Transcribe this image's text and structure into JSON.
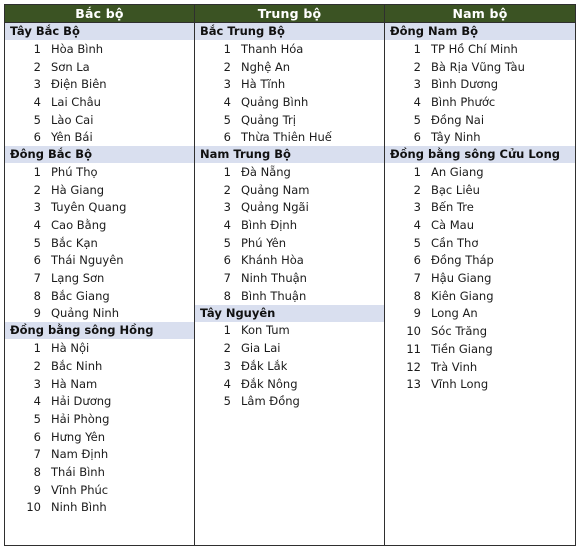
{
  "colors": {
    "header_bg": "#3b5323",
    "header_text": "#ffffff",
    "group_header_bg": "#d9dfef",
    "group_header_text": "#111111",
    "body_text": "#1b1b1b",
    "border": "#2f2f2f",
    "page_bg": "#ffffff"
  },
  "table": {
    "columns": [
      {
        "header": "Bắc bộ",
        "groups": [
          {
            "title": "Tây Bắc Bộ",
            "items": [
              {
                "num": "1",
                "name": "Hòa Bình"
              },
              {
                "num": "2",
                "name": "Sơn La"
              },
              {
                "num": "3",
                "name": "Điện Biên"
              },
              {
                "num": "4",
                "name": "Lai Châu"
              },
              {
                "num": "5",
                "name": "Lào Cai"
              },
              {
                "num": "6",
                "name": "Yên Bái"
              }
            ]
          },
          {
            "title": "Đông Bắc Bộ",
            "items": [
              {
                "num": "1",
                "name": "Phú Thọ"
              },
              {
                "num": "2",
                "name": "Hà Giang"
              },
              {
                "num": "3",
                "name": "Tuyên Quang"
              },
              {
                "num": "4",
                "name": "Cao Bằng"
              },
              {
                "num": "5",
                "name": "Bắc Kạn"
              },
              {
                "num": "6",
                "name": "Thái Nguyên"
              },
              {
                "num": "7",
                "name": "Lạng Sơn"
              },
              {
                "num": "8",
                "name": "Bắc Giang"
              },
              {
                "num": "9",
                "name": "Quảng Ninh"
              }
            ]
          },
          {
            "title": "Đồng bằng sông Hồng",
            "items": [
              {
                "num": "1",
                "name": "Hà Nội"
              },
              {
                "num": "2",
                "name": "Bắc Ninh"
              },
              {
                "num": "3",
                "name": "Hà Nam"
              },
              {
                "num": "4",
                "name": "Hải Dương"
              },
              {
                "num": "5",
                "name": "Hải Phòng"
              },
              {
                "num": "6",
                "name": "Hưng Yên"
              },
              {
                "num": "7",
                "name": "Nam Định"
              },
              {
                "num": "8",
                "name": "Thái Bình"
              },
              {
                "num": "9",
                "name": "Vĩnh Phúc"
              },
              {
                "num": "10",
                "name": "Ninh Bình"
              }
            ]
          }
        ]
      },
      {
        "header": "Trung bộ",
        "groups": [
          {
            "title": "Bắc Trung Bộ",
            "items": [
              {
                "num": "1",
                "name": "Thanh Hóa"
              },
              {
                "num": "2",
                "name": "Nghệ An"
              },
              {
                "num": "3",
                "name": "Hà Tĩnh"
              },
              {
                "num": "4",
                "name": "Quảng Bình"
              },
              {
                "num": "5",
                "name": "Quảng Trị"
              },
              {
                "num": "6",
                "name": "Thừa Thiên Huế"
              }
            ]
          },
          {
            "title": "Nam Trung Bộ",
            "items": [
              {
                "num": "1",
                "name": "Đà Nẵng"
              },
              {
                "num": "2",
                "name": "Quảng Nam"
              },
              {
                "num": "3",
                "name": "Quảng Ngãi"
              },
              {
                "num": "4",
                "name": "Bình Định"
              },
              {
                "num": "5",
                "name": "Phú Yên"
              },
              {
                "num": "6",
                "name": "Khánh Hòa"
              },
              {
                "num": "7",
                "name": "Ninh Thuận"
              },
              {
                "num": "8",
                "name": "Bình Thuận"
              }
            ]
          },
          {
            "title": "Tây Nguyên",
            "items": [
              {
                "num": "1",
                "name": "Kon Tum"
              },
              {
                "num": "2",
                "name": "Gia Lai"
              },
              {
                "num": "3",
                "name": "Đắk Lắk"
              },
              {
                "num": "4",
                "name": "Đắk Nông"
              },
              {
                "num": "5",
                "name": "Lâm Đồng"
              }
            ]
          }
        ]
      },
      {
        "header": "Nam bộ",
        "groups": [
          {
            "title": "Đông Nam Bộ",
            "items": [
              {
                "num": "1",
                "name": "TP Hồ Chí Minh"
              },
              {
                "num": "2",
                "name": "Bà Rịa Vũng Tàu"
              },
              {
                "num": "3",
                "name": "Bình Dương"
              },
              {
                "num": "4",
                "name": "Bình Phước"
              },
              {
                "num": "5",
                "name": "Đồng Nai"
              },
              {
                "num": "6",
                "name": "Tây Ninh"
              }
            ]
          },
          {
            "title": "Đồng bằng sông Cửu Long",
            "items": [
              {
                "num": "1",
                "name": "An Giang"
              },
              {
                "num": "2",
                "name": "Bạc Liêu"
              },
              {
                "num": "3",
                "name": "Bến Tre"
              },
              {
                "num": "4",
                "name": "Cà Mau"
              },
              {
                "num": "5",
                "name": "Cần Thơ"
              },
              {
                "num": "6",
                "name": "Đồng Tháp"
              },
              {
                "num": "7",
                "name": "Hậu Giang"
              },
              {
                "num": "8",
                "name": "Kiên Giang"
              },
              {
                "num": "9",
                "name": "Long An"
              },
              {
                "num": "10",
                "name": "Sóc Trăng"
              },
              {
                "num": "11",
                "name": "Tiền Giang"
              },
              {
                "num": "12",
                "name": "Trà Vinh"
              },
              {
                "num": "13",
                "name": "Vĩnh Long"
              }
            ]
          }
        ]
      }
    ]
  }
}
